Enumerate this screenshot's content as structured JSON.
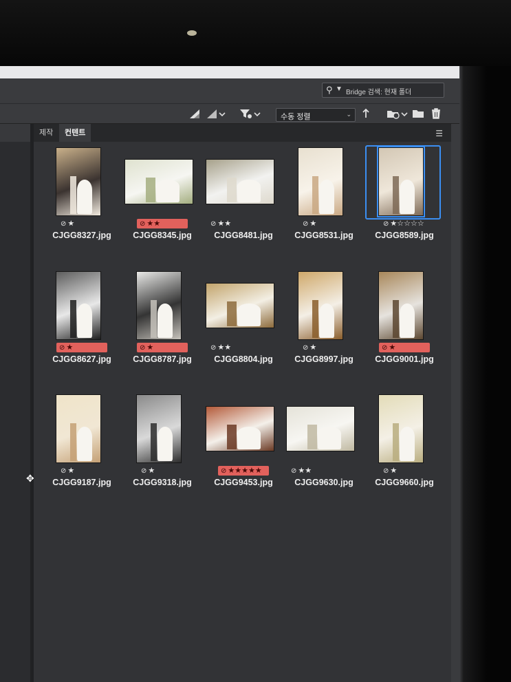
{
  "search": {
    "placeholder": "Bridge 검색: 현재 폴더"
  },
  "toolbar": {
    "quality_icon": "thumbnail-quality-icon",
    "sort_value": "수동 정렬",
    "filter_icon": "filter-icon",
    "new_folder_icon": "folder-icon",
    "delete_icon": "trash-icon"
  },
  "panel": {
    "tabs": [
      {
        "label": "제작"
      },
      {
        "label": "컨텐트"
      }
    ]
  },
  "colors": {
    "label_red": "#e2615c",
    "selection": "#3b8ff3",
    "panel_bg": "#323336"
  },
  "items": [
    {
      "name": "CJGG8327.jpg",
      "reject": "⊘",
      "stars": "★",
      "labeled": false,
      "orientation": "portrait"
    },
    {
      "name": "CJGG8345.jpg",
      "reject": "⊘",
      "stars": "★★",
      "labeled": true,
      "orientation": "landscape"
    },
    {
      "name": "CJGG8481.jpg",
      "reject": "⊘",
      "stars": "★★",
      "labeled": false,
      "orientation": "landscape"
    },
    {
      "name": "CJGG8531.jpg",
      "reject": "⊘",
      "stars": "★",
      "labeled": false,
      "orientation": "portrait"
    },
    {
      "name": "CJGG8589.jpg",
      "reject": "⊘",
      "stars": "★☆☆☆☆",
      "labeled": false,
      "orientation": "portrait",
      "selected": true
    },
    {
      "name": "CJGG8627.jpg",
      "reject": "⊘",
      "stars": "★",
      "labeled": true,
      "orientation": "portrait"
    },
    {
      "name": "CJGG8787.jpg",
      "reject": "⊘",
      "stars": "★",
      "labeled": true,
      "orientation": "portrait"
    },
    {
      "name": "CJGG8804.jpg",
      "reject": "⊘",
      "stars": "★★",
      "labeled": false,
      "orientation": "landscape"
    },
    {
      "name": "CJGG8997.jpg",
      "reject": "⊘",
      "stars": "★",
      "labeled": false,
      "orientation": "portrait"
    },
    {
      "name": "CJGG9001.jpg",
      "reject": "⊘",
      "stars": "★",
      "labeled": true,
      "orientation": "portrait"
    },
    {
      "name": "CJGG9187.jpg",
      "reject": "⊘",
      "stars": "★",
      "labeled": false,
      "orientation": "portrait"
    },
    {
      "name": "CJGG9318.jpg",
      "reject": "⊘",
      "stars": "★",
      "labeled": false,
      "orientation": "portrait"
    },
    {
      "name": "CJGG9453.jpg",
      "reject": "⊘",
      "stars": "★★★★★",
      "labeled": true,
      "orientation": "landscape"
    },
    {
      "name": "CJGG9630.jpg",
      "reject": "⊘",
      "stars": "★★",
      "labeled": false,
      "orientation": "landscape"
    },
    {
      "name": "CJGG9660.jpg",
      "reject": "⊘",
      "stars": "★",
      "labeled": false,
      "orientation": "portrait"
    }
  ]
}
